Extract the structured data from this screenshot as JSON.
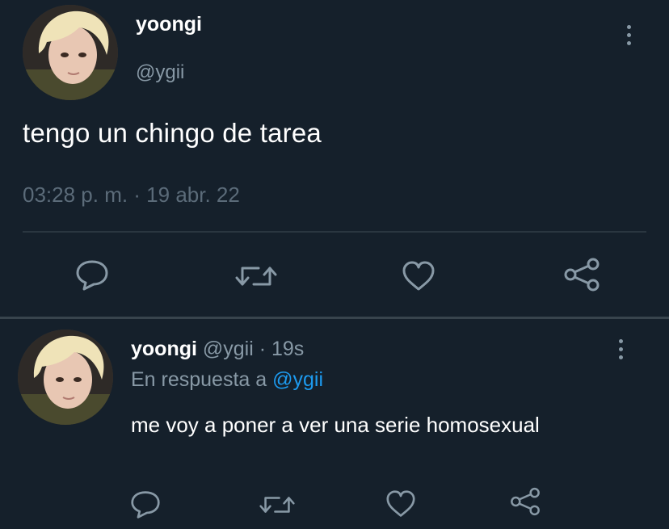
{
  "main_tweet": {
    "display_name": "yoongi",
    "handle": "@ygii",
    "text": "tengo un chingo de tarea",
    "timestamp": "03:28 p. m. · 19 abr. 22",
    "avatar_icon": "profile-photo",
    "more_icon": "more-vertical-icon",
    "actions": [
      "reply-icon",
      "retweet-icon",
      "like-icon",
      "share-icon"
    ]
  },
  "reply_tweet": {
    "display_name": "yoongi",
    "handle": "@ygii",
    "separator": " · ",
    "time_ago": "19s",
    "reply_prefix": "En respuesta a ",
    "reply_mention": "@ygii",
    "text": "me voy a poner a ver una serie homosexual",
    "more_icon": "more-vertical-icon",
    "actions": [
      "reply-icon",
      "retweet-icon",
      "like-icon",
      "share-icon"
    ]
  },
  "colors": {
    "background": "#15202b",
    "primary_text": "#ffffff",
    "secondary_text": "#8899a6",
    "accent": "#1d9bf0",
    "divider": "#38444d"
  }
}
